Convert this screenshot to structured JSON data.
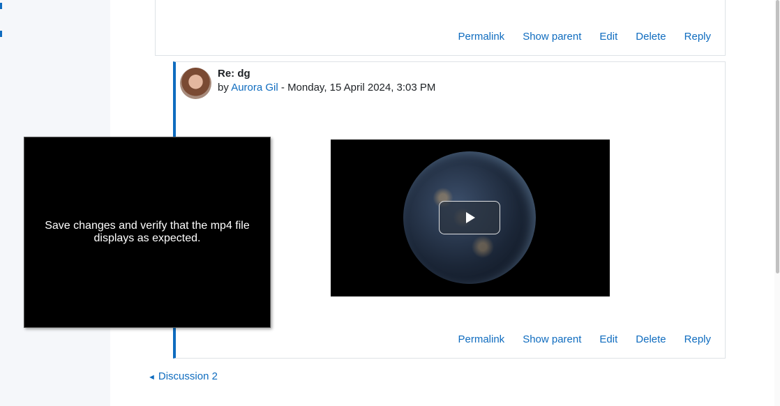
{
  "post_actions": {
    "permalink": "Permalink",
    "show_parent": "Show parent",
    "edit": "Edit",
    "delete": "Delete",
    "reply": "Reply"
  },
  "reply_post": {
    "title": "Re: dg",
    "by_label": "by",
    "author": "Aurora Gil",
    "separator": "-",
    "date": "Monday, 15 April 2024, 3:03 PM"
  },
  "tooltip": {
    "text": "Save changes and verify that the mp4 file displays as expected."
  },
  "navigation": {
    "prev_arrow": "◄",
    "prev_label": "Discussion 2"
  },
  "colors": {
    "link": "#0f6cbf",
    "accent_border": "#0f6cbf"
  }
}
